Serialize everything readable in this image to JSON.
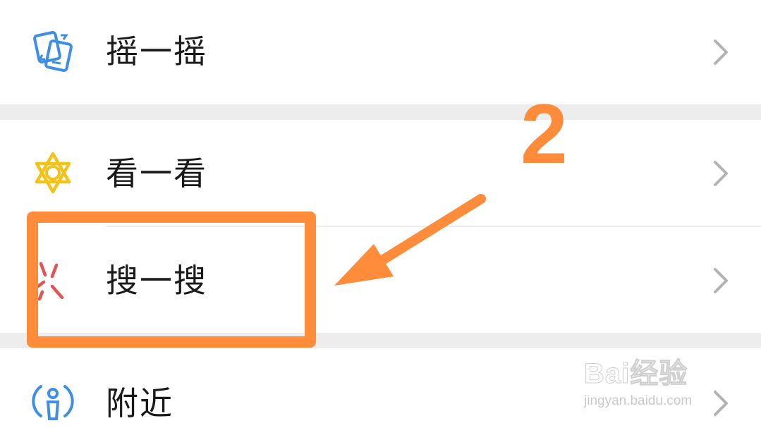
{
  "menu": {
    "items": [
      {
        "label": "摇一摇",
        "icon": "shake-icon",
        "color": "#3f8ee6"
      },
      {
        "label": "看一看",
        "icon": "top-stories-icon",
        "color": "#f2c31b"
      },
      {
        "label": "搜一搜",
        "icon": "search-icon",
        "color": "#e15356"
      },
      {
        "label": "附近",
        "icon": "nearby-icon",
        "color": "#3f8ee6"
      }
    ],
    "chevron_icon": "chevron-right-icon"
  },
  "annotation": {
    "step_number": "2",
    "color": "#ff8c3a",
    "arrow_icon": "arrow-icon"
  },
  "watermark": {
    "logo_text": "Bai经验",
    "url": "jingyan.baidu.com"
  },
  "colors": {
    "background": "#ffffff",
    "separator": "#ededed",
    "text": "#1a1a1a",
    "chevron": "#b3b3b3"
  }
}
